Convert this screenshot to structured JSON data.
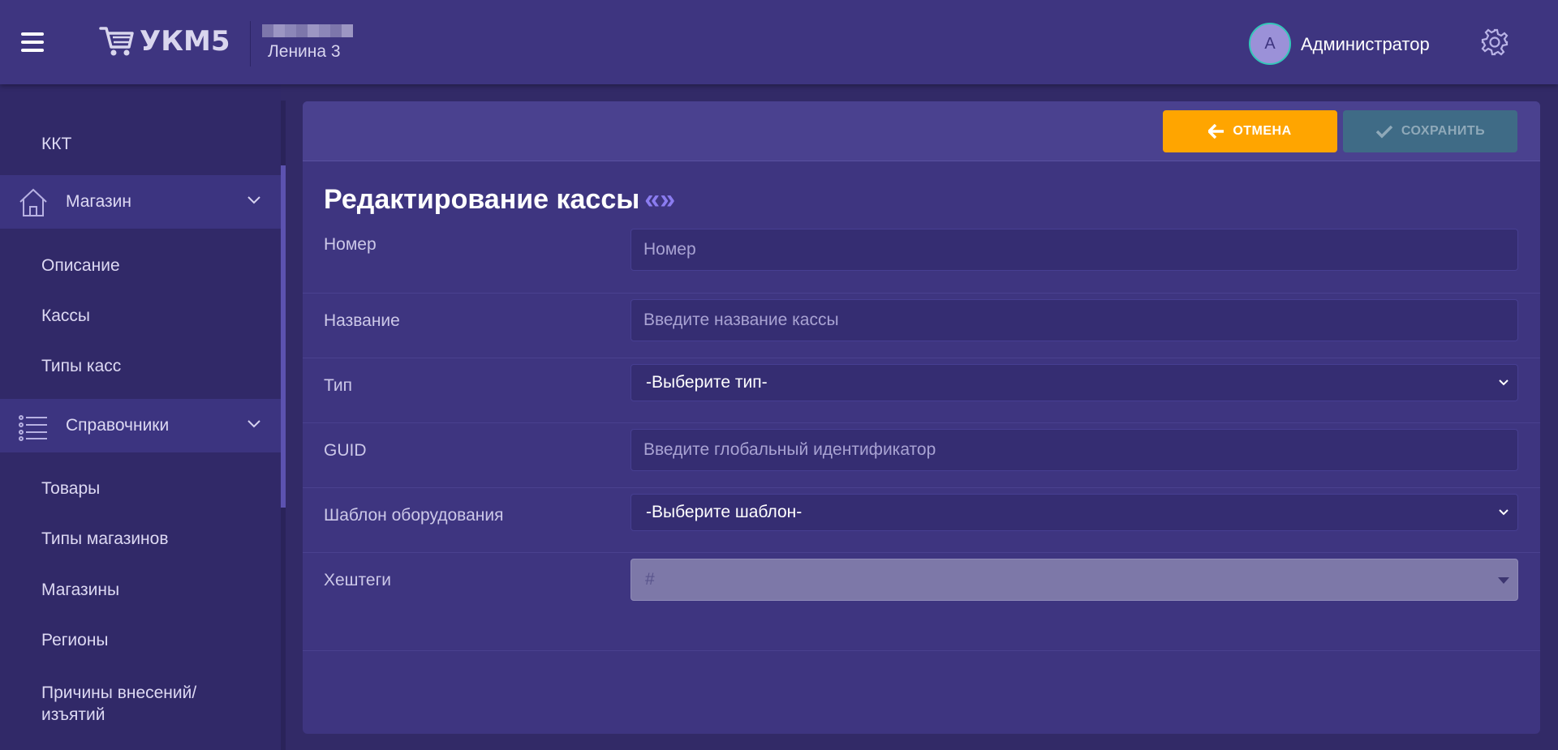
{
  "header": {
    "logo_text": "УКМ5",
    "store_name": "Ленина 3",
    "avatar_letter": "А",
    "user_name": "Администратор"
  },
  "sidebar": {
    "kkt": "ККТ",
    "store_group": "Магазин",
    "store_items": [
      "Описание",
      "Кассы",
      "Типы касс"
    ],
    "ref_group": "Справочники",
    "ref_items": [
      "Товары",
      "Типы магазинов",
      "Магазины",
      "Регионы"
    ],
    "reasons_line1": "Причины внесений/",
    "reasons_line2": "изъятий"
  },
  "toolbar": {
    "cancel_label": "ОТМЕНА",
    "save_label": "СОХРАНИТЬ"
  },
  "form": {
    "title": "Редактирование кассы",
    "title_quotes": "«»",
    "number_label": "Номер",
    "number_placeholder": "Номер",
    "name_label": "Название",
    "name_placeholder": "Введите название кассы",
    "type_label": "Тип",
    "type_value": "-Выберите тип-",
    "guid_label": "GUID",
    "guid_placeholder": "Введите глобальный идентификатор",
    "template_label": "Шаблон оборудования",
    "template_value": "-Выберите шаблон-",
    "tags_label": "Хештеги",
    "tags_placeholder": "#"
  },
  "colors": {
    "header_bg": "#3e3580",
    "sidebar_bg": "#312968",
    "panel_bg": "#3e3580",
    "cancel_button": "#ffa500",
    "save_button_disabled": "#3f6b86",
    "avatar_ring": "#34c7b9"
  }
}
